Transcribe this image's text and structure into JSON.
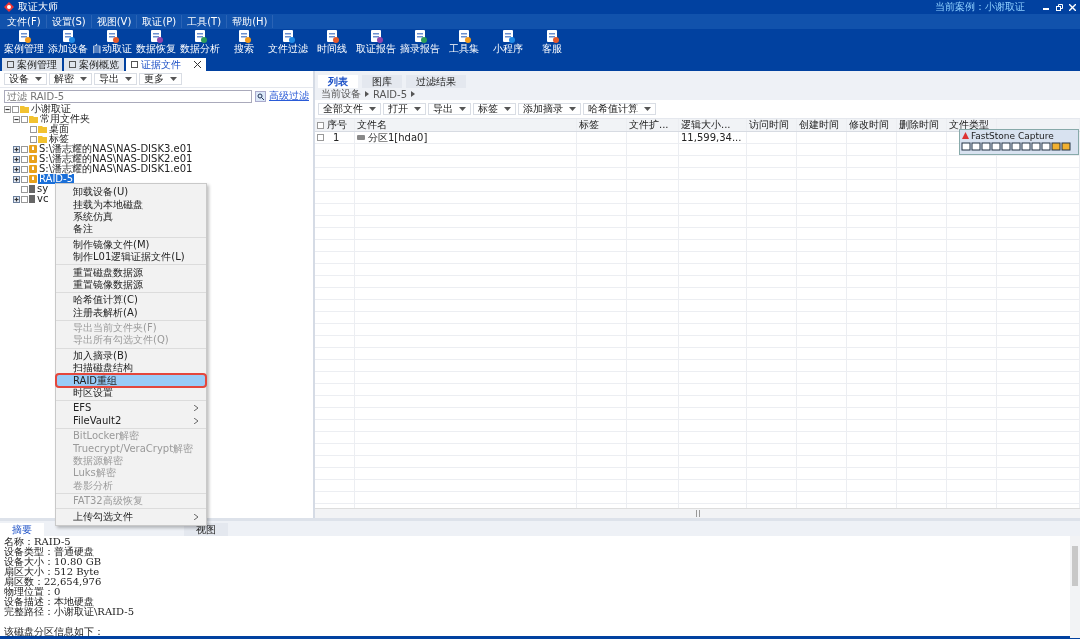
{
  "window": {
    "title": "取证大师",
    "current_case": "当前案例：小谢取证"
  },
  "menu": [
    "文件(F)",
    "设置(S)",
    "视图(V)",
    "取证(P)",
    "工具(T)",
    "帮助(H)"
  ],
  "toolbar": [
    "案例管理",
    "添加设备",
    "自动取证",
    "数据恢复",
    "数据分析",
    "搜索",
    "文件过滤",
    "时间线",
    "取证报告",
    "摘录报告",
    "工具集",
    "小程序",
    "客服"
  ],
  "doc_tabs": [
    {
      "label": "案例管理",
      "selected": false,
      "closable": false
    },
    {
      "label": "案例概览",
      "selected": false,
      "closable": false
    },
    {
      "label": "证据文件",
      "selected": true,
      "closable": true
    }
  ],
  "left": {
    "buttons": [
      "设备",
      "解密",
      "导出",
      "更多"
    ],
    "filter": {
      "placeholder": "过滤 RAID-5"
    },
    "advanced_link": "高级过滤",
    "tree": [
      {
        "label": "小谢取证",
        "kind": "folder",
        "expanded": true,
        "selected": false,
        "checked": false,
        "children": [
          {
            "label": "常用文件夹",
            "kind": "folder",
            "expanded": true,
            "selected": false,
            "checked": false,
            "children": [
              {
                "label": "桌面",
                "kind": "folder",
                "selected": false,
                "checked": false
              },
              {
                "label": "标签",
                "kind": "folder",
                "selected": false,
                "checked": false
              }
            ]
          },
          {
            "label": "S:\\潘志耀的NAS\\NAS-DISK3.e01",
            "kind": "disk",
            "expanded": false,
            "selected": false,
            "checked": false
          },
          {
            "label": "S:\\潘志耀的NAS\\NAS-DISK2.e01",
            "kind": "disk",
            "expanded": false,
            "selected": false,
            "checked": false
          },
          {
            "label": "S:\\潘志耀的NAS\\NAS-DISK1.e01",
            "kind": "disk",
            "expanded": false,
            "selected": false,
            "checked": false
          },
          {
            "label": "RAID-5",
            "kind": "disk",
            "expanded": false,
            "selected": true,
            "checked": false
          },
          {
            "label": "sy",
            "kind": "drive",
            "selected": false,
            "checked": false
          },
          {
            "label": "vc",
            "kind": "drive",
            "expanded": false,
            "selected": false,
            "checked": false
          }
        ]
      }
    ]
  },
  "right": {
    "tabs": [
      {
        "label": "列表",
        "selected": true
      },
      {
        "label": "图库",
        "selected": false
      },
      {
        "label": "过滤结果",
        "selected": false
      }
    ],
    "breadcrumb": [
      "当前设备",
      "RAID-5"
    ],
    "buttons": [
      "全部文件",
      "打开",
      "导出",
      "标签",
      "添加摘录",
      "哈希值计算"
    ],
    "table": {
      "columns": [
        "序号",
        "文件名",
        "标签",
        "文件扩...",
        "逻辑大小...",
        "访问时间",
        "创建时间",
        "修改时间",
        "删除时间",
        "文件类型"
      ],
      "rows": [
        {
          "cells": [
            "1",
            "分区1[hda0]",
            "",
            "",
            "11,599,34...",
            "",
            "",
            "",
            "",
            ""
          ],
          "checked": false
        }
      ]
    }
  },
  "capture_toolbar": {
    "title": "FastStone Capture"
  },
  "context_menu": {
    "sections": [
      [
        {
          "label": "卸载设备(U)",
          "disabled": false,
          "selected": false,
          "annotated": false,
          "submenu": false
        },
        {
          "label": "挂载为本地磁盘",
          "disabled": false,
          "selected": false,
          "annotated": false,
          "submenu": false
        },
        {
          "label": "系统仿真",
          "disabled": false,
          "selected": false,
          "annotated": false,
          "submenu": false
        },
        {
          "label": "备注",
          "disabled": false,
          "selected": false,
          "annotated": false,
          "submenu": false
        }
      ],
      [
        {
          "label": "制作镜像文件(M)",
          "disabled": false,
          "selected": false,
          "annotated": false,
          "submenu": false
        },
        {
          "label": "制作L01逻辑证据文件(L)",
          "disabled": false,
          "selected": false,
          "annotated": false,
          "submenu": false
        }
      ],
      [
        {
          "label": "重置磁盘数据源",
          "disabled": false,
          "selected": false,
          "annotated": false,
          "submenu": false
        },
        {
          "label": "重置镜像数据源",
          "disabled": false,
          "selected": false,
          "annotated": false,
          "submenu": false
        }
      ],
      [
        {
          "label": "哈希值计算(C)",
          "disabled": false,
          "selected": false,
          "annotated": false,
          "submenu": false
        },
        {
          "label": "注册表解析(A)",
          "disabled": false,
          "selected": false,
          "annotated": false,
          "submenu": false
        }
      ],
      [
        {
          "label": "导出当前文件夹(F)",
          "disabled": true,
          "selected": false,
          "annotated": false,
          "submenu": false
        },
        {
          "label": "导出所有勾选文件(Q)",
          "disabled": true,
          "selected": false,
          "annotated": false,
          "submenu": false
        }
      ],
      [
        {
          "label": "加入摘录(B)",
          "disabled": false,
          "selected": false,
          "annotated": false,
          "submenu": false
        },
        {
          "label": "扫描磁盘结构",
          "disabled": false,
          "selected": false,
          "annotated": false,
          "submenu": false
        },
        {
          "label": "RAID重组",
          "disabled": false,
          "selected": true,
          "annotated": true,
          "submenu": false
        },
        {
          "label": "时区设置",
          "disabled": false,
          "selected": false,
          "annotated": false,
          "submenu": false
        }
      ],
      [
        {
          "label": "EFS",
          "disabled": false,
          "selected": false,
          "annotated": false,
          "submenu": true
        },
        {
          "label": "FileVault2",
          "disabled": false,
          "selected": false,
          "annotated": false,
          "submenu": true
        }
      ],
      [
        {
          "label": "BitLocker解密",
          "disabled": true,
          "selected": false,
          "annotated": false,
          "submenu": false
        },
        {
          "label": "Truecrypt/VeraCrypt解密",
          "disabled": true,
          "selected": false,
          "annotated": false,
          "submenu": false
        },
        {
          "label": "数据源解密",
          "disabled": true,
          "selected": false,
          "annotated": false,
          "submenu": false
        },
        {
          "label": "Luks解密",
          "disabled": true,
          "selected": false,
          "annotated": false,
          "submenu": false
        },
        {
          "label": "卷影分析",
          "disabled": true,
          "selected": false,
          "annotated": false,
          "submenu": false
        }
      ],
      [
        {
          "label": "FAT32高级恢复",
          "disabled": true,
          "selected": false,
          "annotated": false,
          "submenu": false
        }
      ],
      [
        {
          "label": "上传勾选文件",
          "disabled": false,
          "selected": false,
          "annotated": false,
          "submenu": true
        }
      ]
    ]
  },
  "bottom": {
    "tabs": [
      {
        "label": "摘要",
        "selected": true
      },
      {
        "label": "视图",
        "selected": false
      }
    ],
    "lines": [
      "名称：RAID-5",
      "设备类型：普通硬盘",
      "设备大小：10.80 GB",
      "扇区大小：512 Byte",
      "扇区数：22,654,976",
      "物理位置：0",
      "设备描述：本地硬盘",
      "完整路径：小谢取证\\RAID-5"
    ],
    "note": "该磁盘分区信息如下："
  }
}
